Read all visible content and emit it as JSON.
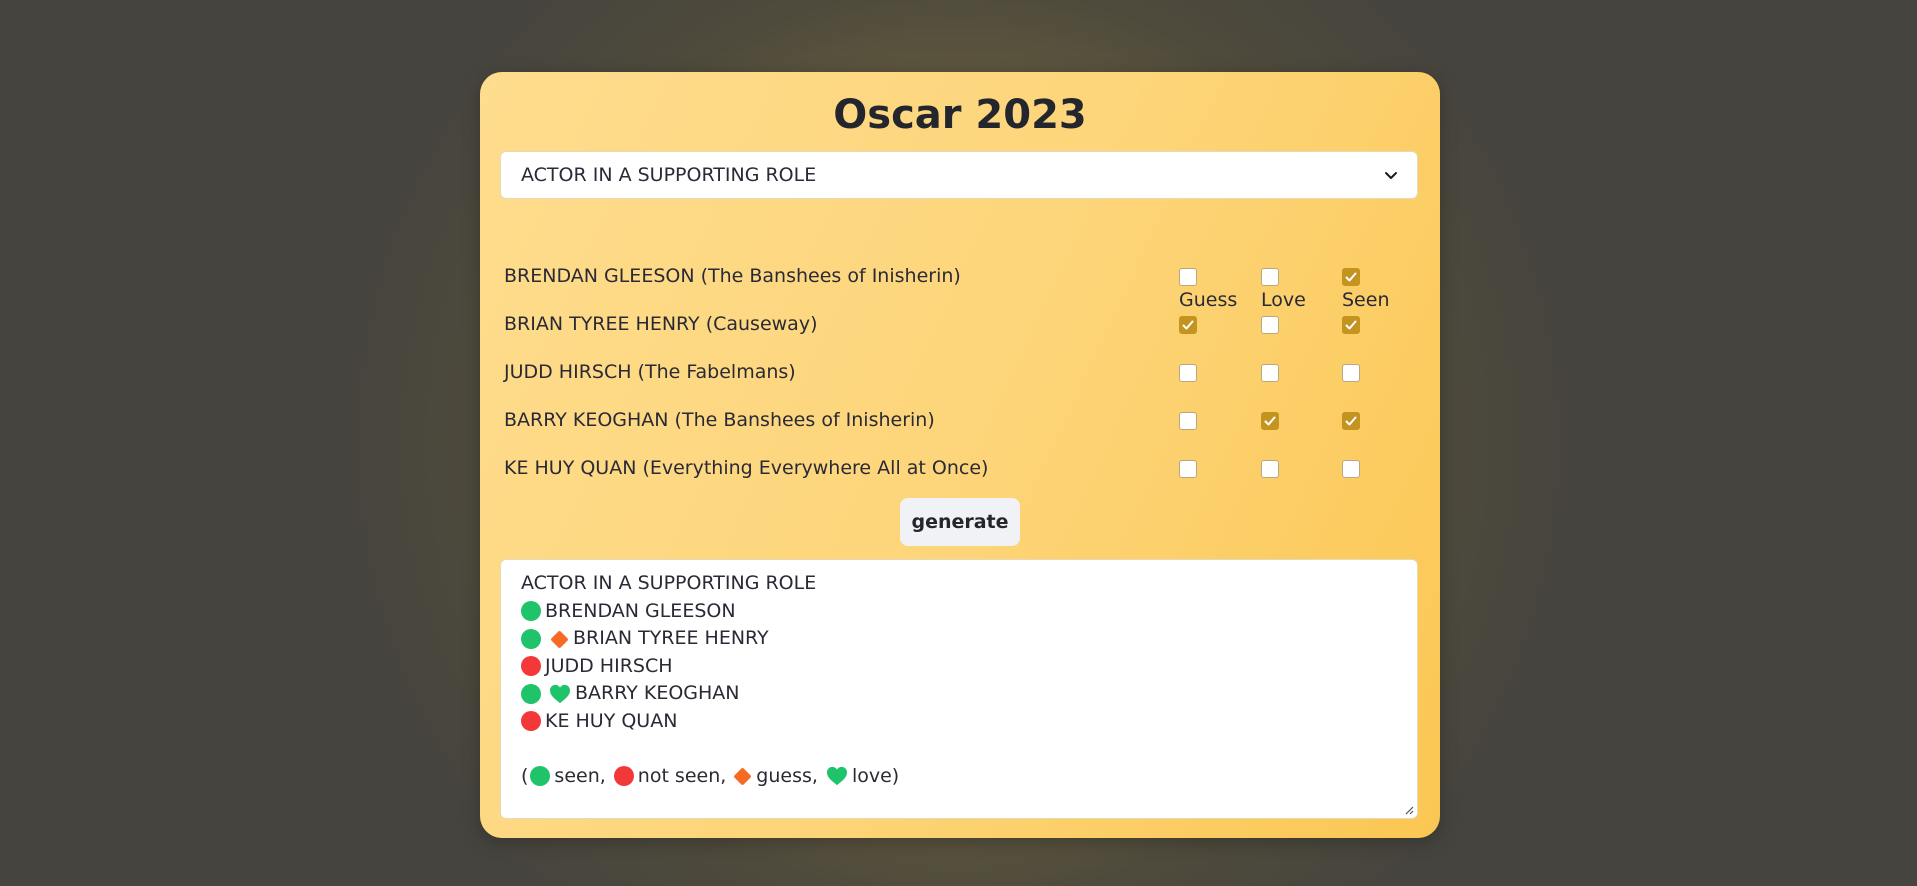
{
  "title": "Oscar 2023",
  "category_select": {
    "selected": "ACTOR IN A SUPPORTING ROLE"
  },
  "columns": [
    "Guess",
    "Love",
    "Seen"
  ],
  "nominees": [
    {
      "label": "BRENDAN GLEESON (The Banshees of Inisherin)",
      "guess": false,
      "love": false,
      "seen": true
    },
    {
      "label": "BRIAN TYREE HENRY (Causeway)",
      "guess": true,
      "love": false,
      "seen": true
    },
    {
      "label": "JUDD HIRSCH (The Fabelmans)",
      "guess": false,
      "love": false,
      "seen": false
    },
    {
      "label": "BARRY KEOGHAN (The Banshees of Inisherin)",
      "guess": false,
      "love": true,
      "seen": true
    },
    {
      "label": "KE HUY QUAN (Everything Everywhere All at Once)",
      "guess": false,
      "love": false,
      "seen": false
    }
  ],
  "generate_label": "generate",
  "output": {
    "heading": "ACTOR IN A SUPPORTING ROLE",
    "lines": [
      "BRENDAN GLEESON",
      "BRIAN TYREE HENRY",
      "JUDD HIRSCH",
      "BARRY KEOGHAN",
      "KE HUY QUAN"
    ],
    "legend": {
      "open": "(",
      "seen": "seen,",
      "not_seen": "not seen,",
      "guess": "guess,",
      "love": "love)"
    }
  },
  "colors": {
    "seen": "#1fc36a",
    "not_seen": "#f23838",
    "guess": "#f56a25",
    "love": "#1fc36a",
    "checkbox_checked": "#c49421",
    "card_gradient_start": "#fedd8e",
    "card_gradient_end": "#fbc753"
  },
  "icons": {
    "seen": "green-circle-icon",
    "not_seen": "red-circle-icon",
    "guess": "orange-diamond-icon",
    "love": "green-heart-icon",
    "select_caret": "chevron-down-icon"
  }
}
